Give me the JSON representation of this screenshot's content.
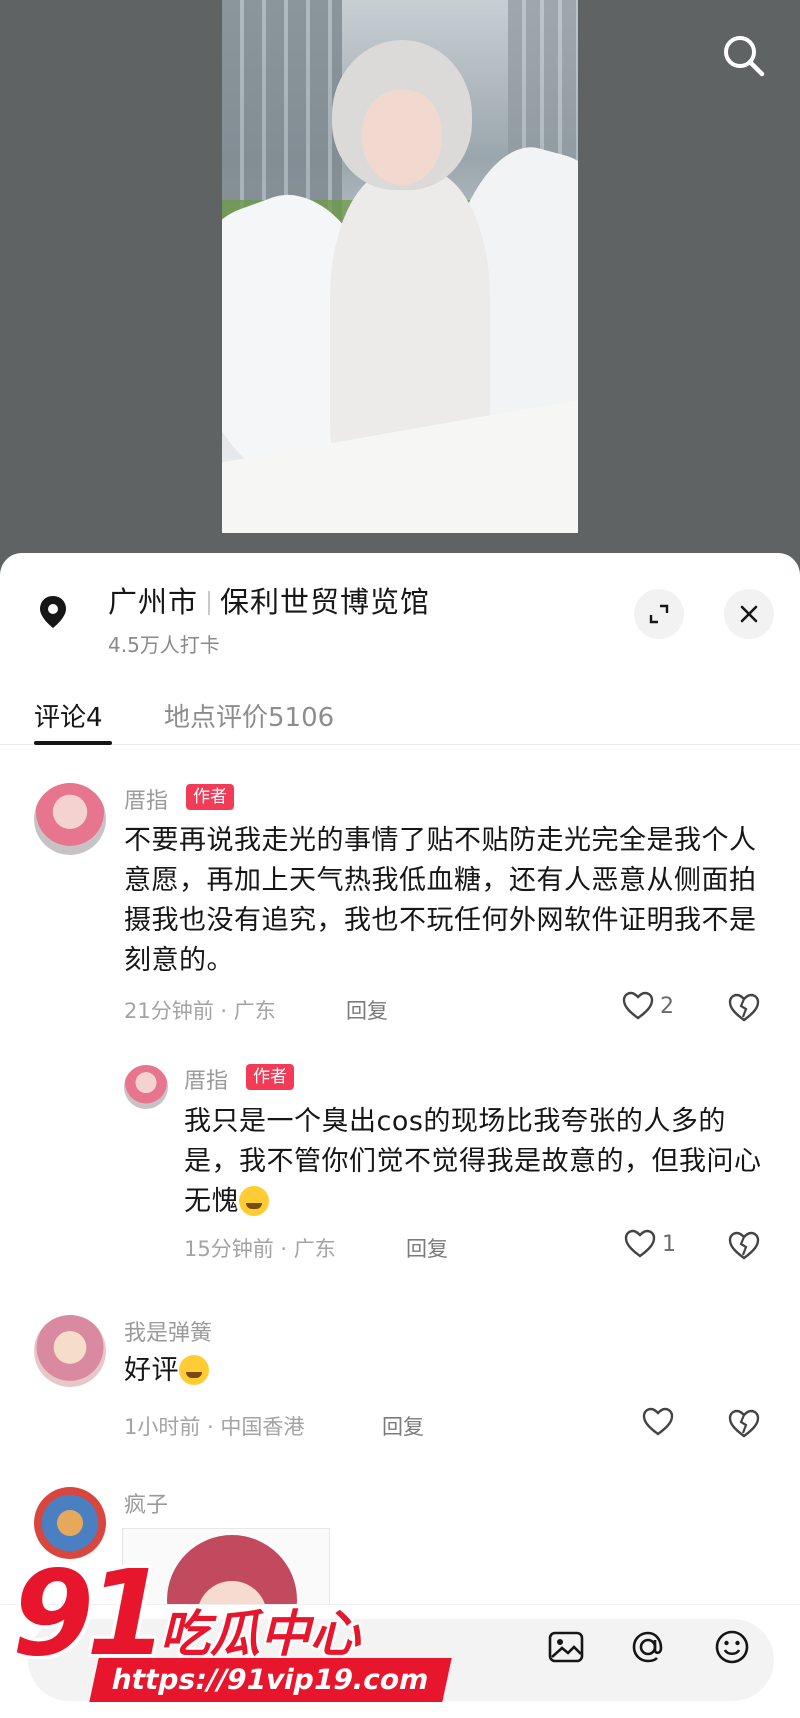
{
  "location": {
    "city": "广州市",
    "venue": "保利世贸博览馆",
    "checkins": "4.5万人打卡"
  },
  "tabs": [
    {
      "label": "评论4",
      "active": true
    },
    {
      "label": "地点评价5106",
      "active": false
    }
  ],
  "comments": [
    {
      "user": "厝指",
      "badge": "作者",
      "text": "不要再说我走光的事情了贴不贴防走光完全是我个人意愿，再加上天气热我低血糖，还有人恶意从侧面拍摄我也没有追究，我也不玩任何外网软件证明我不是刻意的。",
      "time": "21分钟前 · 广东",
      "reply": "回复",
      "likes": "2"
    },
    {
      "user": "厝指",
      "badge": "作者",
      "text": "我只是一个臭出cos的现场比我夸张的人多的是，我不管你们觉不觉得我是故意的，但我问心无愧",
      "time": "15分钟前 · 广东",
      "reply": "回复",
      "likes": "1"
    },
    {
      "user": "我是弹簧",
      "text": "好评",
      "time": "1小时前 · 中国香港",
      "reply": "回复",
      "likes": ""
    },
    {
      "user": "疯子"
    }
  ],
  "watermark": {
    "number": "91",
    "brand": "吃瓜中心",
    "url": "https://91vip19.com"
  },
  "icons": {
    "search": "search-icon",
    "location": "location-pin-icon",
    "expand": "expand-icon",
    "close": "close-icon",
    "like": "heart-icon",
    "dislike": "broken-heart-icon",
    "image": "image-icon",
    "mention": "at-icon",
    "emoji": "emoji-icon"
  },
  "colors": {
    "badge": "#f23b57",
    "watermark": "#e8162c"
  }
}
